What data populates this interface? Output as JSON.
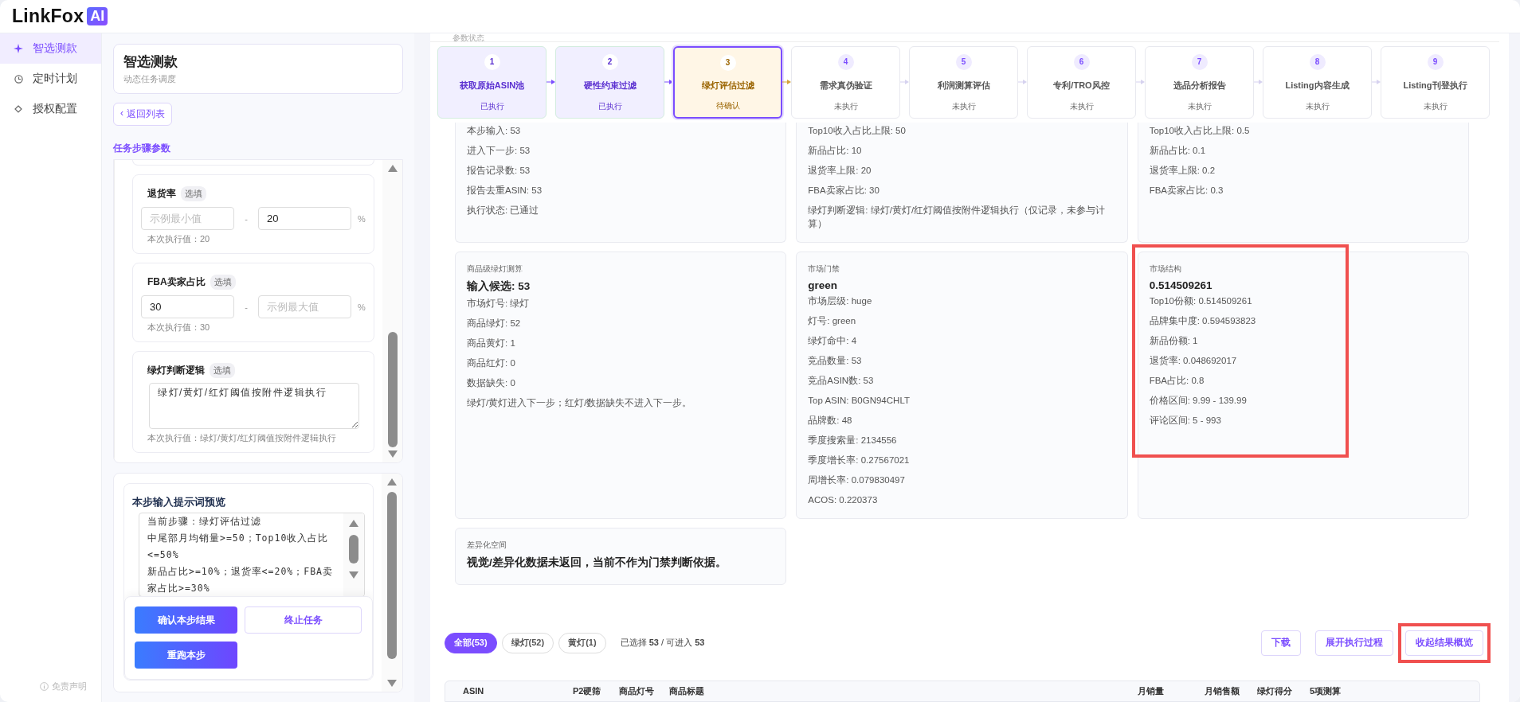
{
  "brand": {
    "name": "LinkFox",
    "badge": "AI"
  },
  "nav": [
    {
      "label": "智选测款",
      "selected": true
    },
    {
      "label": "定时计划",
      "selected": false
    },
    {
      "label": "授权配置",
      "selected": false
    }
  ],
  "disclaimer": "免责声明",
  "task": {
    "title": "智选测款",
    "subtitle": "动态任务调度",
    "back": "返回列表",
    "back_icon": "‹"
  },
  "params": {
    "heading": "任务步骤参数",
    "fields": [
      {
        "kind": "range",
        "label": "退货率",
        "badge": "选填",
        "min": {
          "placeholder": "示例最小值"
        },
        "max": {
          "value": "20"
        },
        "separator": "-",
        "unit": "%",
        "current": "本次执行值：20"
      },
      {
        "kind": "range",
        "label": "FBA卖家占比",
        "badge": "选填",
        "min": {
          "value": "30"
        },
        "max": {
          "placeholder": "示例最大值"
        },
        "separator": "-",
        "unit": "%",
        "current": "本次执行值：30"
      },
      {
        "kind": "text",
        "label": "绿灯判断逻辑",
        "badge": "选填",
        "value": "绿灯/黄灯/红灯阈值按附件逻辑执行",
        "current": "本次执行值：绿灯/黄灯/红灯阈值按附件逻辑执行"
      }
    ]
  },
  "preview": {
    "title": "本步输入提示词预览",
    "lines": [
      "当前步骤：绿灯评估过滤",
      "中尾部月均销量>=50；Top10收入占比<=50%",
      "新品占比>=10%；退货率<=20%；FBA卖家占比>=30%"
    ]
  },
  "actions": [
    {
      "label": "确认本步结果",
      "kind": "primary"
    },
    {
      "label": "终止任务",
      "kind": "outline"
    },
    {
      "label": "重跑本步",
      "kind": "primary"
    }
  ],
  "peek_label": "参数状态",
  "steps": [
    {
      "number": "1",
      "title": "获取原始ASIN池",
      "status": "已执行",
      "done": true,
      "selected": false
    },
    {
      "number": "2",
      "title": "硬性约束过滤",
      "status": "已执行",
      "done": true,
      "selected": false
    },
    {
      "number": "3",
      "title": "绿灯评估过滤",
      "status": "待确认",
      "done": false,
      "selected": true
    },
    {
      "number": "4",
      "title": "需求真伪验证",
      "status": "未执行",
      "done": false,
      "selected": false
    },
    {
      "number": "5",
      "title": "利润测算评估",
      "status": "未执行",
      "done": false,
      "selected": false
    },
    {
      "number": "6",
      "title": "专利/TRO风控",
      "status": "未执行",
      "done": false,
      "selected": false
    },
    {
      "number": "7",
      "title": "选品分析报告",
      "status": "未执行",
      "done": false,
      "selected": false
    },
    {
      "number": "8",
      "title": "Listing内容生成",
      "status": "未执行",
      "done": false,
      "selected": false
    },
    {
      "number": "9",
      "title": "Listing刊登执行",
      "status": "未执行",
      "done": false,
      "selected": false
    }
  ],
  "cards": [
    {
      "cut": true,
      "highlighted": false,
      "lines": [
        "本步输入: 53",
        "进入下一步: 53",
        "报告记录数: 53",
        "报告去重ASIN: 53",
        "执行状态: 已通过"
      ]
    },
    {
      "cut": true,
      "highlighted": false,
      "lines": [
        "Top10收入占比上限: 50",
        "新品占比: 10",
        "退货率上限: 20",
        "FBA卖家占比: 30",
        "绿灯判断逻辑: 绿灯/黄灯/红灯阈值按附件逻辑执行（仅记录，未参与计算）"
      ]
    },
    {
      "cut": true,
      "highlighted": false,
      "lines": [
        "Top10收入占比上限: 0.5",
        "新品占比: 0.1",
        "退货率上限: 0.2",
        "FBA卖家占比: 0.3"
      ]
    },
    {
      "cut": false,
      "highlighted": false,
      "title": "商品级绿灯测算",
      "headline": "输入候选: 53",
      "lines": [
        "市场灯号: 绿灯",
        "商品绿灯: 52",
        "商品黄灯: 1",
        "商品红灯: 0",
        "数据缺失: 0",
        "绿灯/黄灯进入下一步；红灯/数据缺失不进入下一步。"
      ]
    },
    {
      "cut": false,
      "highlighted": false,
      "title": "市场门禁",
      "headline": "green",
      "lines": [
        "市场层级: huge",
        "灯号: green",
        "绿灯命中: 4",
        "竞品数量: 53",
        "竞品ASIN数: 53",
        "Top ASIN: B0GN94CHLT",
        "品牌数: 48",
        "季度搜索量: 2134556",
        "季度增长率: 0.27567021",
        "周增长率: 0.079830497",
        "ACOS: 0.220373"
      ]
    },
    {
      "cut": false,
      "highlighted": true,
      "title": "市场结构",
      "headline": "0.514509261",
      "lines": [
        "Top10份额: 0.514509261",
        "品牌集中度: 0.594593823",
        "新品份额: 1",
        "退货率: 0.048692017",
        "FBA占比: 0.8",
        "价格区间: 9.99 - 139.99",
        "评论区间: 5 - 993"
      ]
    },
    {
      "cut": false,
      "highlighted": false,
      "title": "差异化空间",
      "headline": "视觉/差异化数据未返回，当前不作为门禁判断依据。"
    }
  ],
  "filters": [
    {
      "label": "全部(53)",
      "selected": true
    },
    {
      "label": "绿灯(52)",
      "selected": false
    },
    {
      "label": "黄灯(1)",
      "selected": false
    }
  ],
  "selection": {
    "prefix": "已选择",
    "selected": "53",
    "middle": "/ 可进入",
    "available": "53"
  },
  "tools": [
    {
      "label": "下载",
      "highlighted": false
    },
    {
      "label": "展开执行过程",
      "highlighted": false
    },
    {
      "label": "收起结果概览",
      "highlighted": true
    }
  ],
  "table": {
    "columns": [
      "ASIN",
      "P2硬筛",
      "商品灯号",
      "商品标题",
      "月销量",
      "月销售额",
      "绿灯得分",
      "5项测算"
    ]
  }
}
